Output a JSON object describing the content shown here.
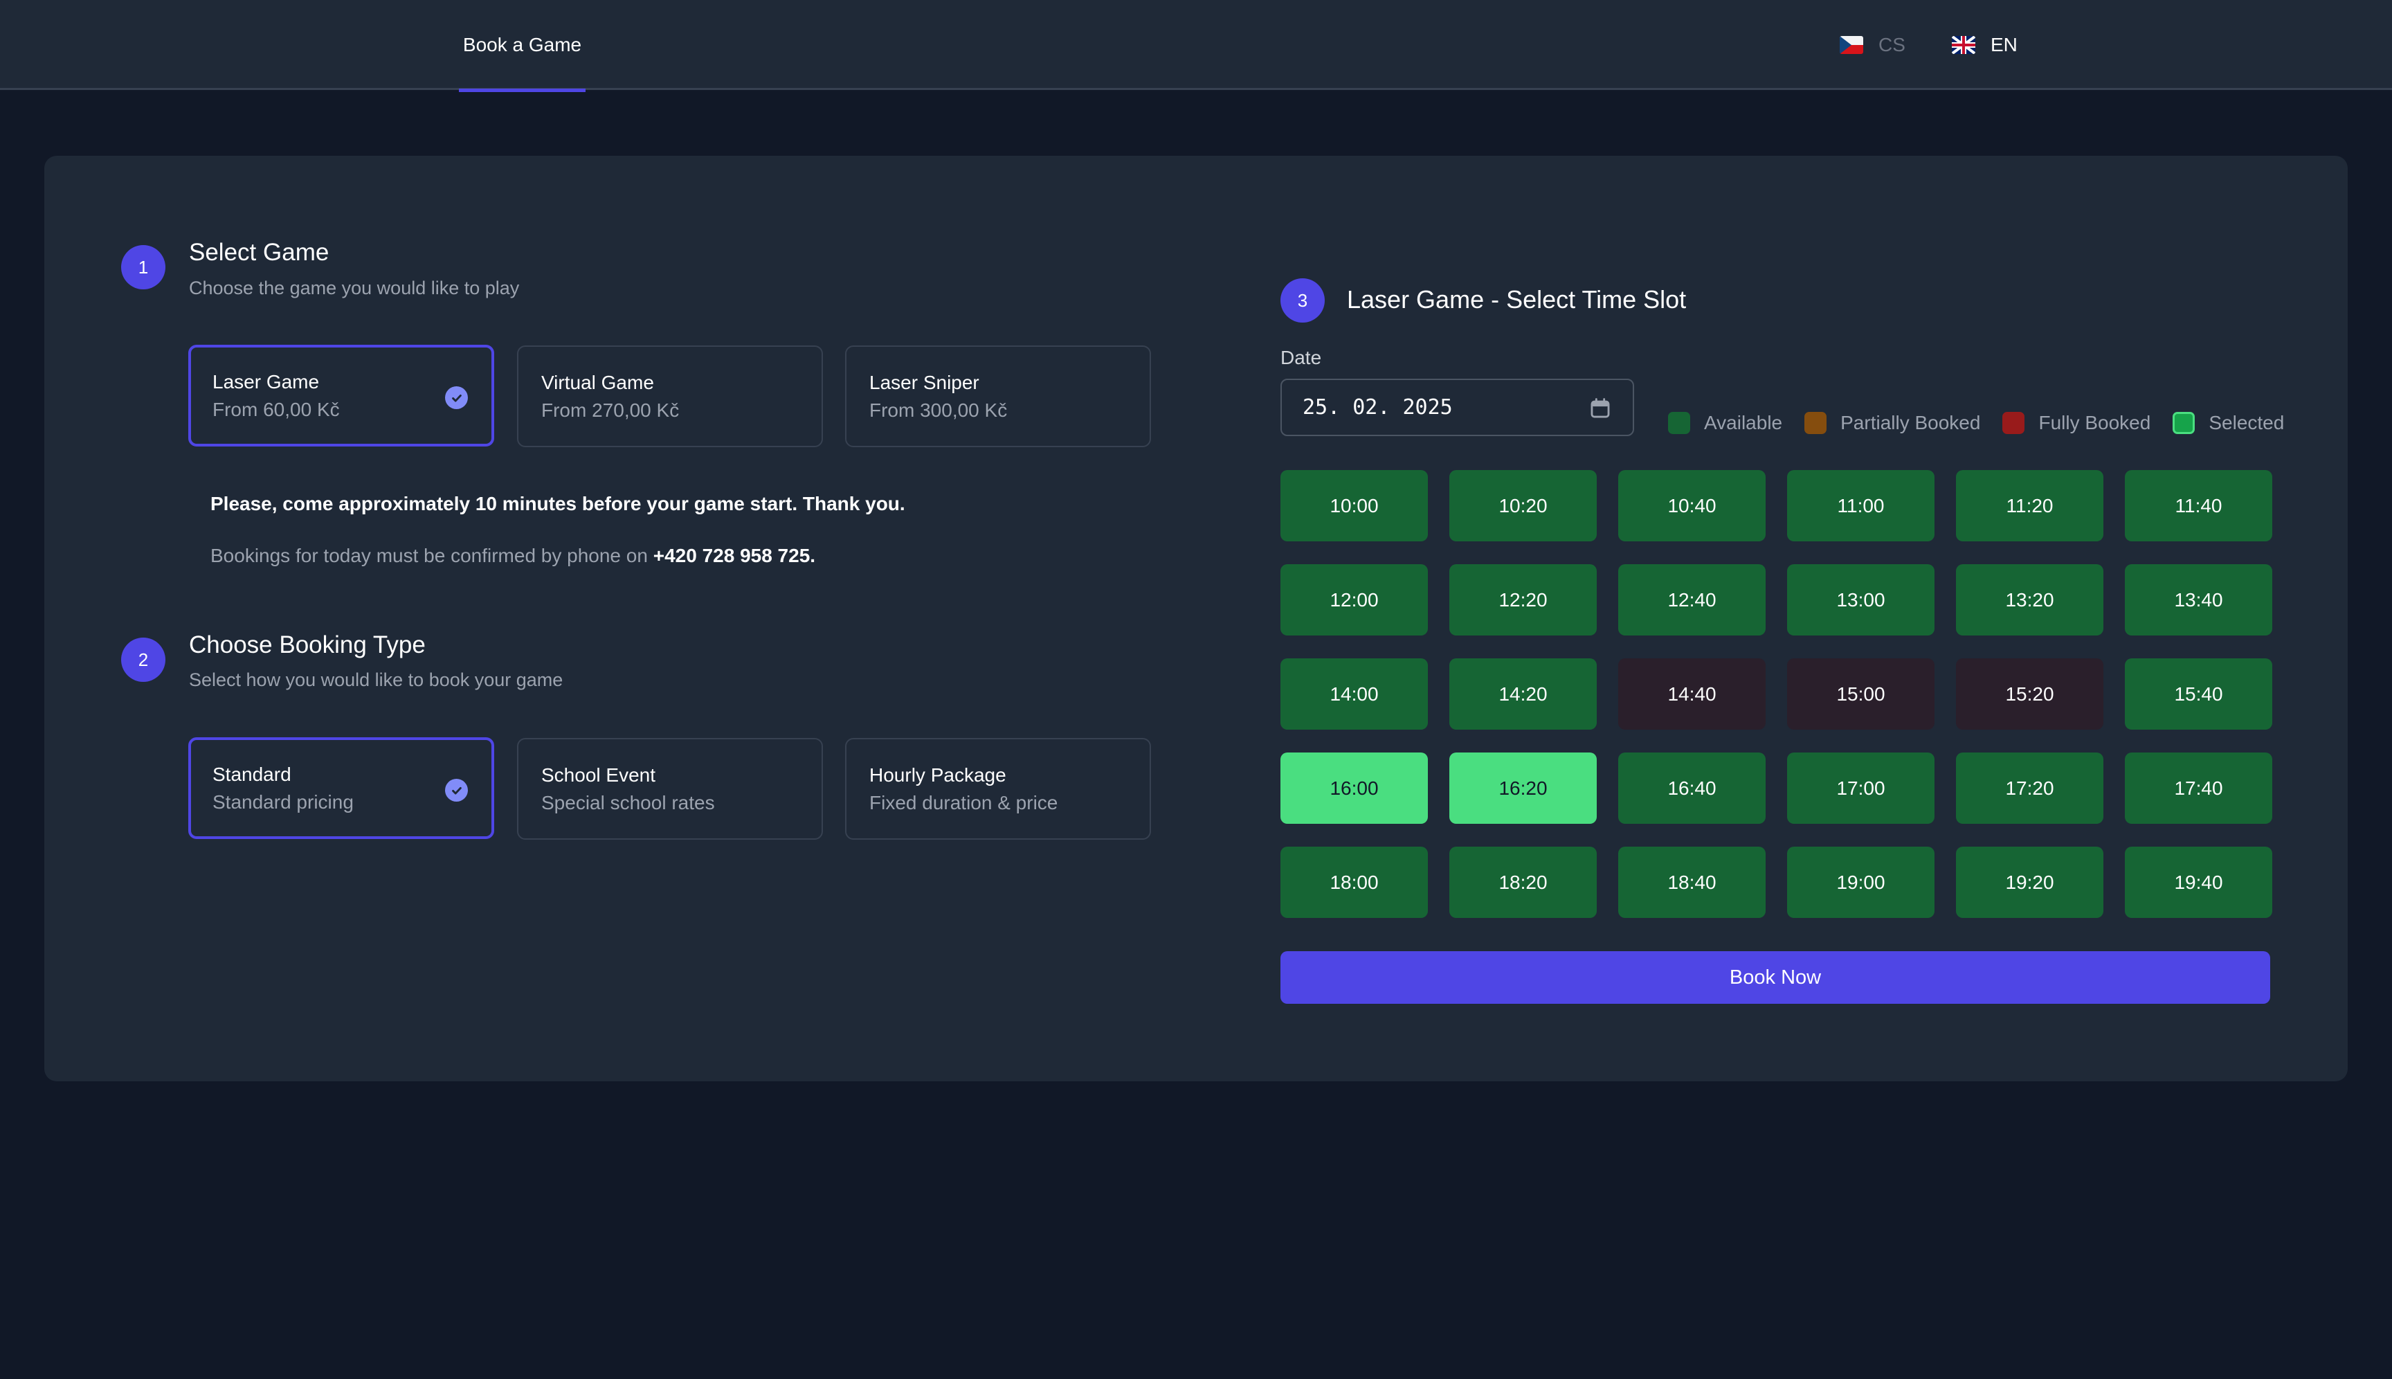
{
  "header": {
    "nav_tab": "Book a Game",
    "languages": [
      {
        "code": "CS",
        "flag": "czech-flag-icon",
        "active": false
      },
      {
        "code": "EN",
        "flag": "uk-flag-icon",
        "active": true
      }
    ]
  },
  "colors": {
    "accent": "#4f46e5",
    "available": "#166534",
    "partially_booked": "#854d0e",
    "fully_booked": "#991b1b",
    "selected": "#16a34a",
    "selected_border": "#4ade80"
  },
  "step1": {
    "number": "1",
    "title": "Select Game",
    "subtitle": "Choose the game you would like to play",
    "options": [
      {
        "title": "Laser Game",
        "subtitle": "From 60,00 Kč",
        "selected": true
      },
      {
        "title": "Virtual Game",
        "subtitle": "From 270,00 Kč",
        "selected": false
      },
      {
        "title": "Laser Sniper",
        "subtitle": "From 300,00 Kč",
        "selected": false
      }
    ]
  },
  "notes": {
    "arrival": "Please, come approximately 10 minutes before your game start. Thank you.",
    "phone_prefix": "Bookings for today must be confirmed by phone on ",
    "phone": "+420 728 958 725."
  },
  "step2": {
    "number": "2",
    "title": "Choose Booking Type",
    "subtitle": "Select how you would like to book your game",
    "options": [
      {
        "title": "Standard",
        "subtitle": "Standard pricing",
        "selected": true
      },
      {
        "title": "School Event",
        "subtitle": "Special school rates",
        "selected": false
      },
      {
        "title": "Hourly Package",
        "subtitle": "Fixed duration & price",
        "selected": false
      }
    ]
  },
  "step3": {
    "number": "3",
    "title": "Laser Game - Select Time Slot",
    "date_label": "Date",
    "date_value": "25. 02. 2025",
    "legend": [
      {
        "label": "Available",
        "key": "available"
      },
      {
        "label": "Partially Booked",
        "key": "partially_booked"
      },
      {
        "label": "Fully Booked",
        "key": "fully_booked"
      },
      {
        "label": "Selected",
        "key": "selected"
      }
    ],
    "slots": [
      {
        "time": "10:00",
        "status": "available"
      },
      {
        "time": "10:20",
        "status": "available"
      },
      {
        "time": "10:40",
        "status": "available"
      },
      {
        "time": "11:00",
        "status": "available"
      },
      {
        "time": "11:20",
        "status": "available"
      },
      {
        "time": "11:40",
        "status": "available"
      },
      {
        "time": "12:00",
        "status": "available"
      },
      {
        "time": "12:20",
        "status": "available"
      },
      {
        "time": "12:40",
        "status": "available"
      },
      {
        "time": "13:00",
        "status": "available"
      },
      {
        "time": "13:20",
        "status": "available"
      },
      {
        "time": "13:40",
        "status": "available"
      },
      {
        "time": "14:00",
        "status": "available"
      },
      {
        "time": "14:20",
        "status": "available"
      },
      {
        "time": "14:40",
        "status": "booked"
      },
      {
        "time": "15:00",
        "status": "booked"
      },
      {
        "time": "15:20",
        "status": "booked"
      },
      {
        "time": "15:40",
        "status": "available"
      },
      {
        "time": "16:00",
        "status": "selected"
      },
      {
        "time": "16:20",
        "status": "selected"
      },
      {
        "time": "16:40",
        "status": "available"
      },
      {
        "time": "17:00",
        "status": "available"
      },
      {
        "time": "17:20",
        "status": "available"
      },
      {
        "time": "17:40",
        "status": "available"
      },
      {
        "time": "18:00",
        "status": "available"
      },
      {
        "time": "18:20",
        "status": "available"
      },
      {
        "time": "18:40",
        "status": "available"
      },
      {
        "time": "19:00",
        "status": "available"
      },
      {
        "time": "19:20",
        "status": "available"
      },
      {
        "time": "19:40",
        "status": "available"
      }
    ],
    "book_button": "Book Now"
  }
}
